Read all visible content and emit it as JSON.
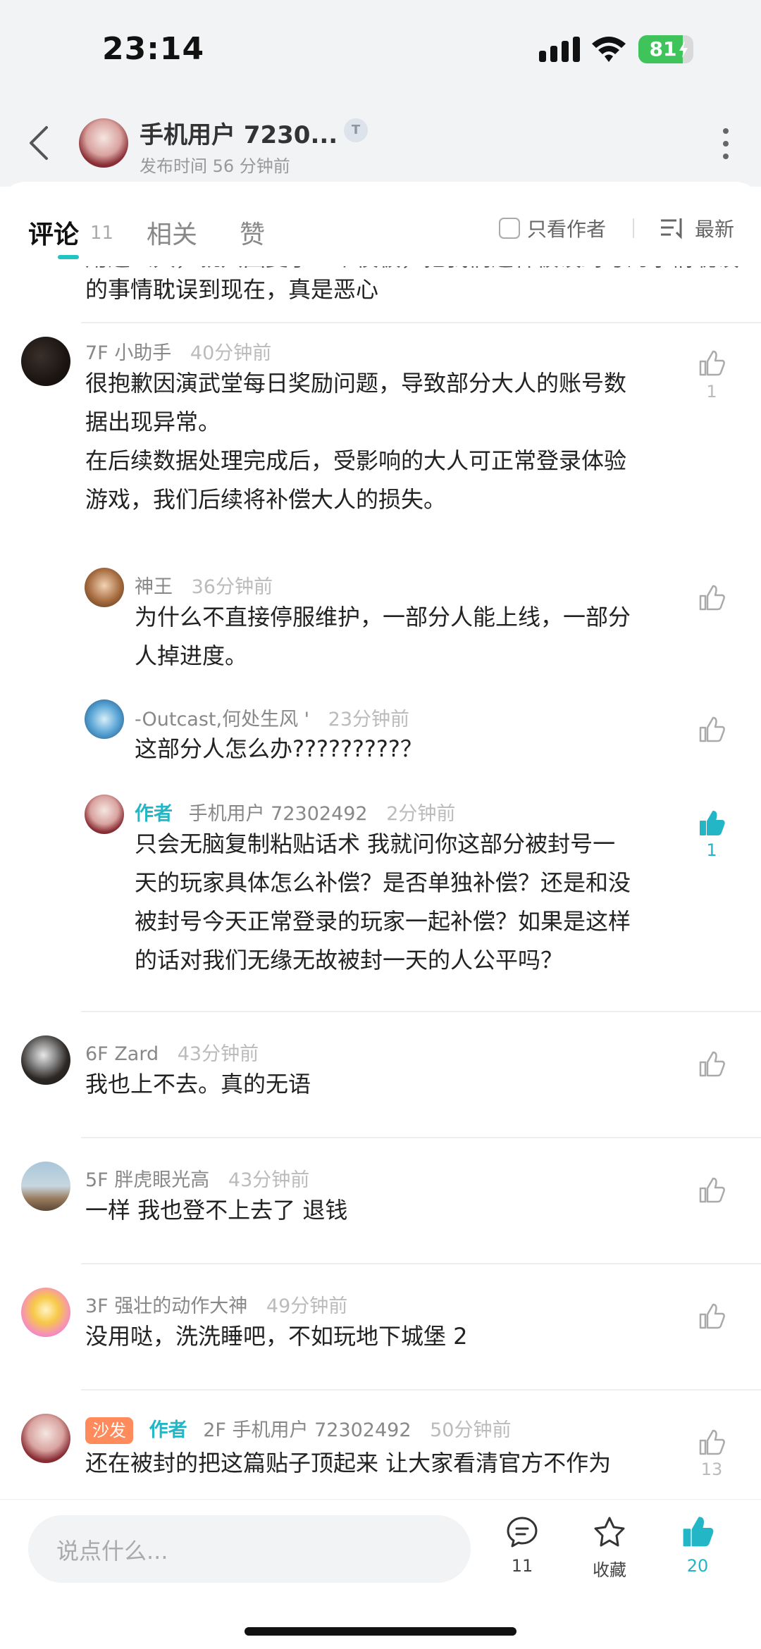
{
  "status_bar": {
    "time": "23:14",
    "battery": "81",
    "battery_level": 0.81
  },
  "header": {
    "author_name": "手机用户 7230...",
    "publish_time": "发布时间 56 分钟前",
    "level_badge": "T"
  },
  "tabs": {
    "comments_label": "评论",
    "comments_count": "11",
    "related_label": "相关",
    "likes_label": "赞",
    "author_only_label": "只看作者",
    "sort_label": "最新"
  },
  "comments": {
    "partial_text_1": "用这么久，就只回复了一个模板，把我们这种被误封号的事情耽误",
    "partial_text_2": "的事情耽误到现在，真是恶心",
    "c7": {
      "floor": "7F",
      "user": "小助手",
      "time": "40分钟前",
      "text_1": "很抱歉因演武堂每日奖励问题，导致部分大人的账号数",
      "text_2": "据出现异常。",
      "text_3": "在后续数据处理完成后，受影响的大人可正常登录体验",
      "text_4": "游戏，我们后续将补偿大人的损失。",
      "likes": "1",
      "replies": [
        {
          "user": "神王",
          "time": "36分钟前",
          "text_1": "为什么不直接停服维护，一部分人能上线，一部分",
          "text_2": "人掉进度。"
        },
        {
          "user": "-Outcast,何处生风 '",
          "time": "23分钟前",
          "text_1": "这部分人怎么办?????????？"
        },
        {
          "author_tag": "作者",
          "user": "手机用户 72302492",
          "time": "2分钟前",
          "text_1": "只会无脑复制粘贴话术 我就问你这部分被封号一",
          "text_2": "天的玩家具体怎么补偿？是否单独补偿？还是和没",
          "text_3": "被封号今天正常登录的玩家一起补偿？如果是这样",
          "text_4": "的话对我们无缘无故被封一天的人公平吗？",
          "likes": "1"
        }
      ]
    },
    "c6": {
      "floor": "6F",
      "user": "Zard",
      "time": "43分钟前",
      "text": "我也上不去。真的无语"
    },
    "c5": {
      "floor": "5F",
      "user": "胖虎眼光高",
      "time": "43分钟前",
      "text": "一样 我也登不上去了 退钱"
    },
    "c3": {
      "floor": "3F",
      "user": "强壮的动作大神",
      "time": "49分钟前",
      "text": "没用哒，洗洗睡吧，不如玩地下城堡 2"
    },
    "c2": {
      "sofa_tag": "沙发",
      "author_tag": "作者",
      "floor": "2F",
      "user": "手机用户 72302492",
      "time": "50分钟前",
      "text": "还在被封的把这篇贴子顶起来 让大家看清官方不作为",
      "likes": "13"
    }
  },
  "bottom_bar": {
    "input_placeholder": "说点什么...",
    "comment_count": "11",
    "favorite_label": "收藏",
    "like_count": "20"
  },
  "colors": {
    "accent": "#22b6c6",
    "sofa": "#ff8a5c",
    "battery": "#3ec45b"
  }
}
